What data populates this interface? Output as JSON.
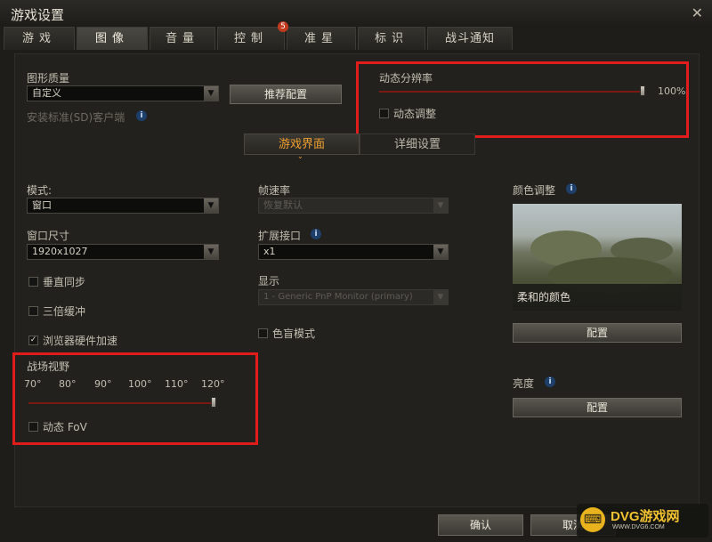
{
  "window": {
    "title": "游戏设置",
    "close": "✕"
  },
  "tabs": [
    {
      "label": "游戏"
    },
    {
      "label": "图像"
    },
    {
      "label": "音量"
    },
    {
      "label": "控制"
    },
    {
      "label": "准星"
    },
    {
      "label": "标识"
    },
    {
      "label": "战斗通知"
    }
  ],
  "active_tab": "图像",
  "control_badge": "5",
  "graphics": {
    "quality_label": "图形质量",
    "quality_value": "自定义",
    "recommend_button": "推荐配置",
    "sd_client_label": "安装标准(SD)客户端"
  },
  "dynamic_resolution": {
    "label": "动态分辨率",
    "value": "100%",
    "level": 1.0,
    "adjust_label": "动态调整",
    "adjust_checked": false
  },
  "subtabs": [
    {
      "label": "游戏界面"
    },
    {
      "label": "详细设置"
    }
  ],
  "active_subtab": "游戏界面",
  "left": {
    "mode_label": "模式:",
    "mode_value": "窗口",
    "size_label": "窗口尺寸",
    "size_value": "1920x1027",
    "vsync_label": "垂直同步",
    "triple_buffer_label": "三倍缓冲",
    "browser_hw_label": "浏览器硬件加速",
    "browser_hw_checked": true
  },
  "fov": {
    "label": "战场视野",
    "ticks": [
      "70°",
      "80°",
      "90°",
      "100°",
      "110°",
      "120°"
    ],
    "value": 120,
    "range": [
      70,
      120
    ],
    "dynamic_label": "动态 FoV",
    "dynamic_checked": false
  },
  "middle": {
    "fps_label": "帧速率",
    "fps_value": "恢复默认",
    "ext_label": "扩展接口",
    "ext_value": "x1",
    "display_label": "显示",
    "display_value": "1 - Generic PnP Monitor (primary)",
    "colorblind_label": "色盲模式"
  },
  "right": {
    "color_label": "颜色调整",
    "color_preset": "柔和的颜色",
    "config_button": "配置",
    "brightness_label": "亮度",
    "brightness_button": "配置"
  },
  "footer": {
    "ok": "确认",
    "cancel": "取消"
  },
  "watermark": {
    "logo": "⌨",
    "text": "DVG游戏网",
    "sub": "WWW.DVG6.COM"
  },
  "colors": {
    "accent_red": "#e01c1c",
    "slider": "#7b1a12",
    "subtab_active": "#f0a030"
  }
}
